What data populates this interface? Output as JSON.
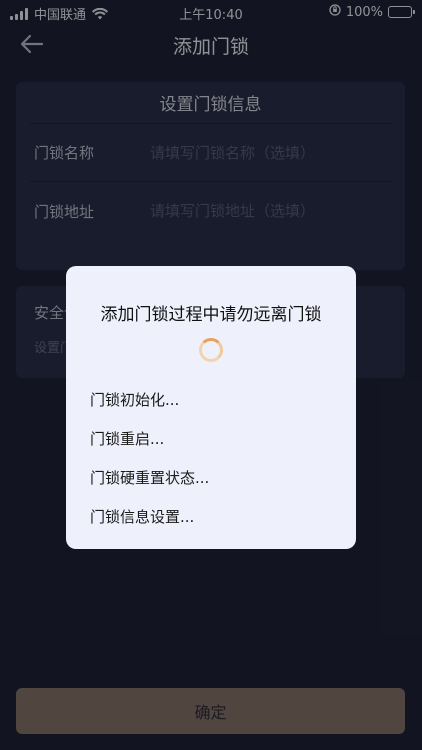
{
  "status_bar": {
    "carrier": "中国联通",
    "time": "上午10:40",
    "battery": "100%",
    "icons": [
      "signal-icon",
      "wifi-icon",
      "orientation-lock-icon",
      "battery-icon"
    ]
  },
  "nav": {
    "title": "添加门锁",
    "back_icon": "arrow-left-icon"
  },
  "info_card": {
    "heading": "设置门锁信息",
    "fields": [
      {
        "label": "门锁名称",
        "placeholder": "请填写门锁名称（选填）",
        "value": ""
      },
      {
        "label": "门锁地址",
        "placeholder": "请填写门锁地址（选填）",
        "value": ""
      }
    ]
  },
  "security_card": {
    "title": "安全设置",
    "subtitle": "设置门锁"
  },
  "confirm_button": {
    "label": "确定"
  },
  "modal": {
    "title": "添加门锁过程中请勿远离门锁",
    "spinner_icon": "loading-spinner-icon",
    "steps": [
      "门锁初始化...",
      "门锁重启...",
      "门锁硬重置状态...",
      "门锁信息设置..."
    ]
  },
  "colors": {
    "background": "#1b1d2f",
    "card": "#262a40",
    "confirm": "#8a7565",
    "modal": "#eef1fb",
    "battery": "#4cd964",
    "spinner": "#e9a060"
  }
}
